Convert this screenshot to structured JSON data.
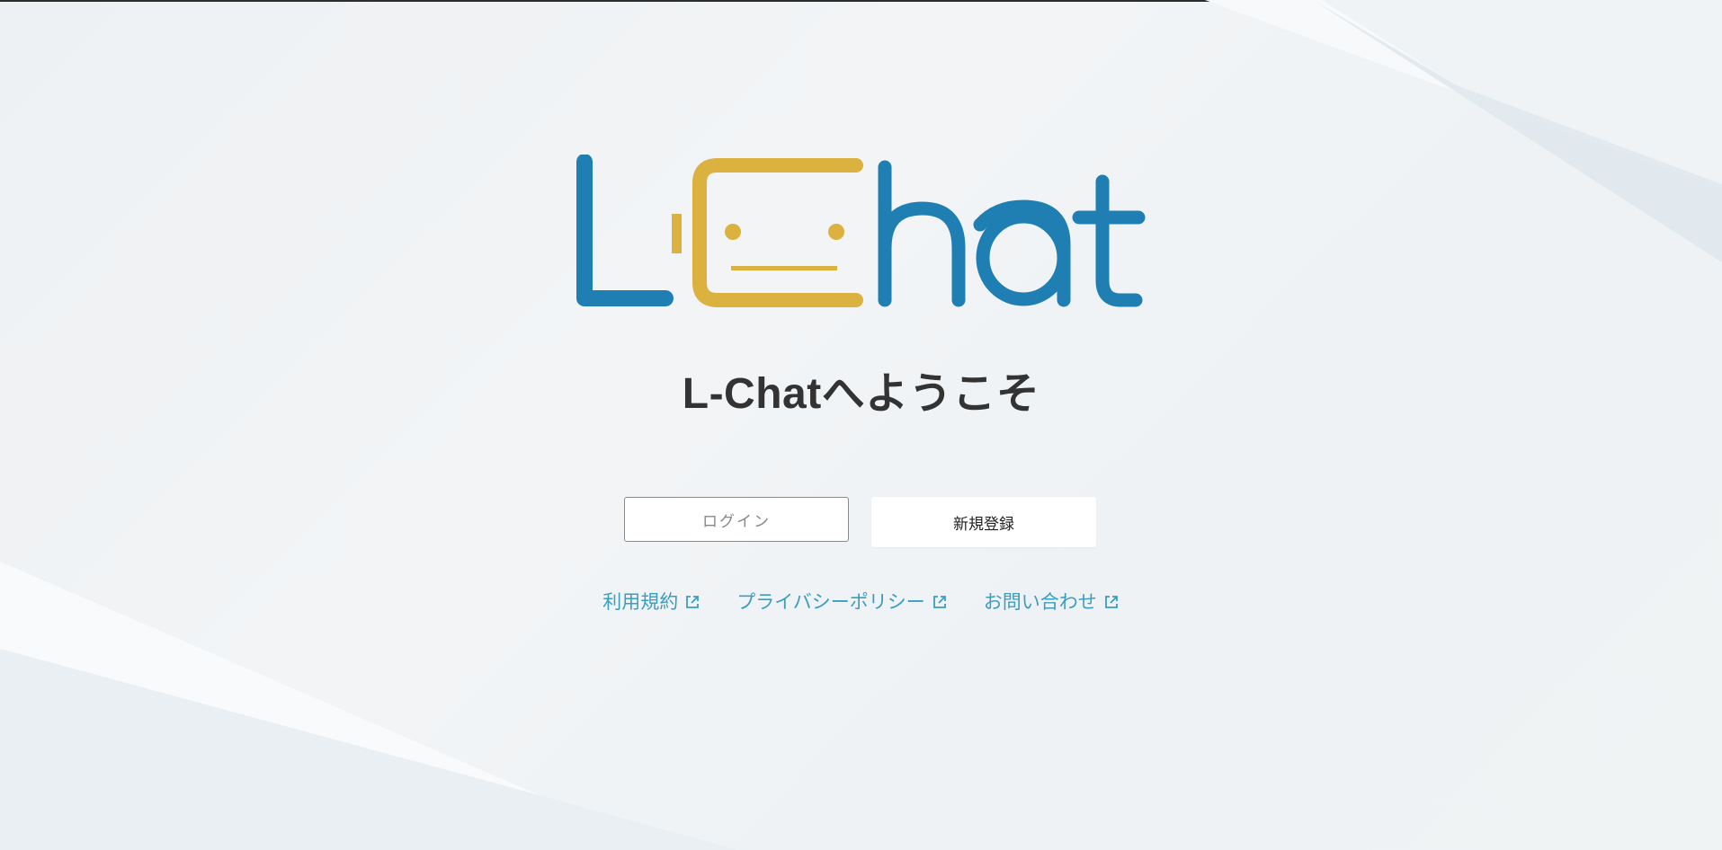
{
  "header": {
    "title": "L-Chatへようこそ"
  },
  "logo": {
    "text": "LChat",
    "colors": {
      "blue": "#1f7fb3",
      "gold": "#dbb13f"
    }
  },
  "actions": {
    "login_label": "ログイン",
    "register_label": "新規登録"
  },
  "footer_links": [
    {
      "label": "利用規約",
      "icon": "external-link-icon"
    },
    {
      "label": "プライバシーポリシー",
      "icon": "external-link-icon"
    },
    {
      "label": "お問い合わせ",
      "icon": "external-link-icon"
    }
  ],
  "colors": {
    "link": "#3b9dbf",
    "heading": "#333333",
    "background": "#eef1f3"
  }
}
